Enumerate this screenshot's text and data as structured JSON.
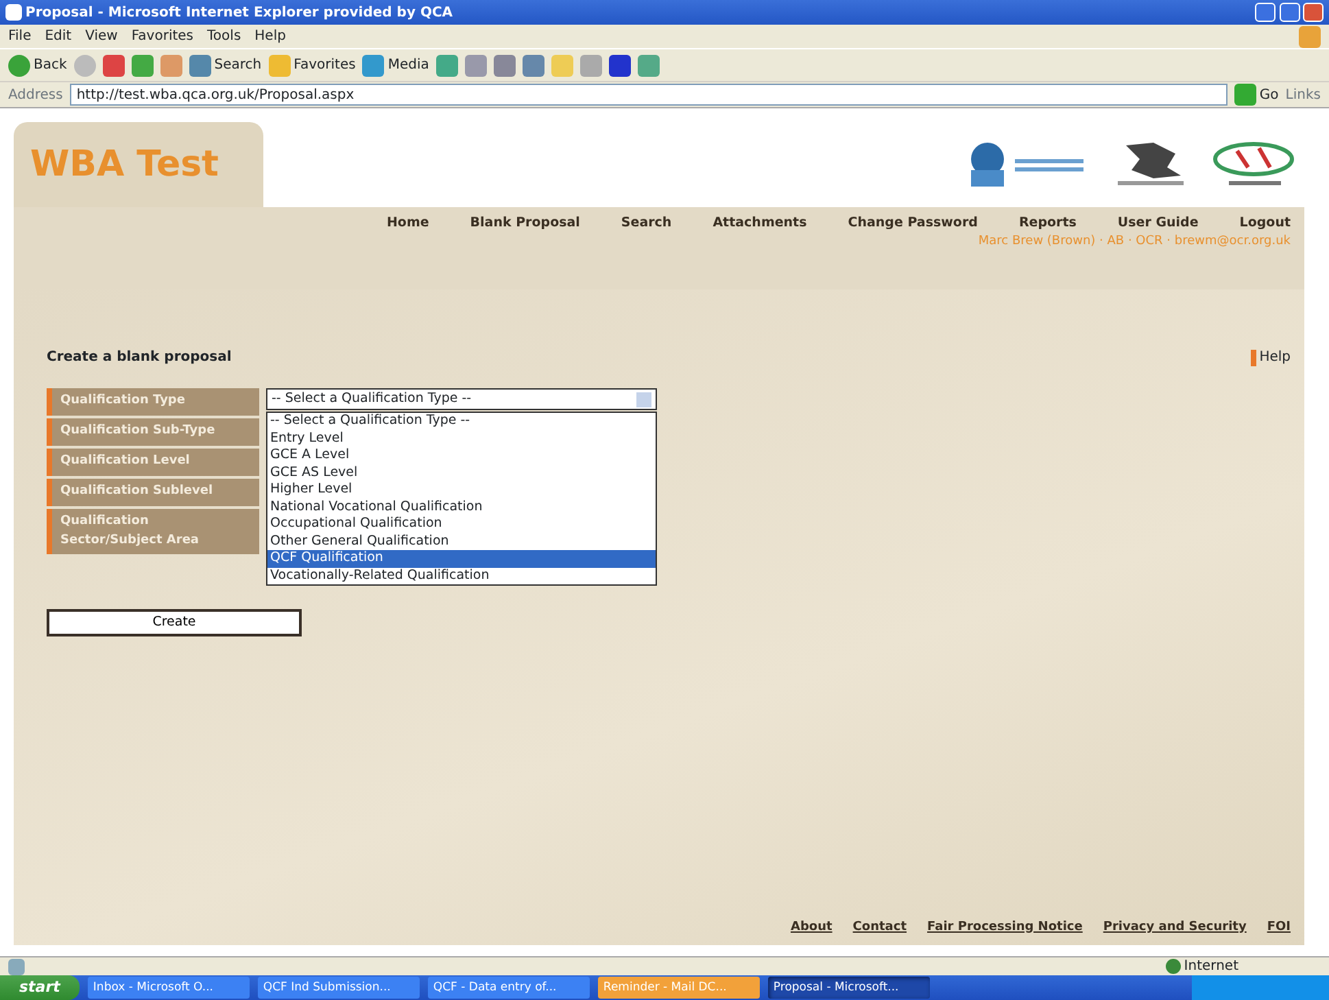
{
  "window": {
    "title": "Proposal - Microsoft Internet Explorer provided by QCA"
  },
  "menu_bar": [
    "File",
    "Edit",
    "View",
    "Favorites",
    "Tools",
    "Help"
  ],
  "toolbar": {
    "back": "Back",
    "search": "Search",
    "favorites": "Favorites",
    "media": "Media"
  },
  "address_bar": {
    "label": "Address",
    "value": "http://test.wba.qca.org.uk/Proposal.aspx",
    "go": "Go",
    "links": "Links"
  },
  "page": {
    "logo": "WBA Test",
    "nav": [
      "Home",
      "Blank Proposal",
      "Search",
      "Attachments",
      "Change Password",
      "Reports",
      "User Guide",
      "Logout"
    ],
    "user_info": "Marc Brew (Brown) · AB · OCR · brewm@ocr.org.uk",
    "heading": "Create a blank proposal",
    "help": "Help",
    "fields": [
      {
        "label": "Qualification Type"
      },
      {
        "label": "Qualification Sub-Type"
      },
      {
        "label": "Qualification Level"
      },
      {
        "label": "Qualification Sublevel"
      },
      {
        "label": "Qualification Sector/Subject Area"
      }
    ],
    "select": {
      "value": "-- Select a Qualification Type --",
      "expanded": true,
      "options": [
        {
          "label": "-- Select a Qualification Type --",
          "highlighted": false
        },
        {
          "label": "Entry Level",
          "highlighted": false
        },
        {
          "label": "GCE A Level",
          "highlighted": false
        },
        {
          "label": "GCE AS Level",
          "highlighted": false
        },
        {
          "label": "Higher Level",
          "highlighted": false
        },
        {
          "label": "National Vocational Qualification",
          "highlighted": false
        },
        {
          "label": "Occupational Qualification",
          "highlighted": false
        },
        {
          "label": "Other General Qualification",
          "highlighted": false
        },
        {
          "label": "QCF Qualification",
          "highlighted": true
        },
        {
          "label": "Vocationally-Related Qualification",
          "highlighted": false
        }
      ]
    },
    "create": "Create",
    "footer": [
      "About",
      "Contact",
      "Fair Processing Notice",
      "Privacy and Security",
      "FOI"
    ]
  },
  "status_bar": {
    "zone": "Internet"
  },
  "taskbar": {
    "start": "start",
    "items": [
      {
        "label": "Inbox - Microsoft O...",
        "selected": false,
        "attention": false
      },
      {
        "label": "QCF Ind Submission...",
        "selected": false,
        "attention": false
      },
      {
        "label": "QCF - Data entry of...",
        "selected": false,
        "attention": false
      },
      {
        "label": "Reminder - Mail DC...",
        "selected": false,
        "attention": true
      },
      {
        "label": "Proposal - Microsoft...",
        "selected": true,
        "attention": false
      }
    ]
  }
}
